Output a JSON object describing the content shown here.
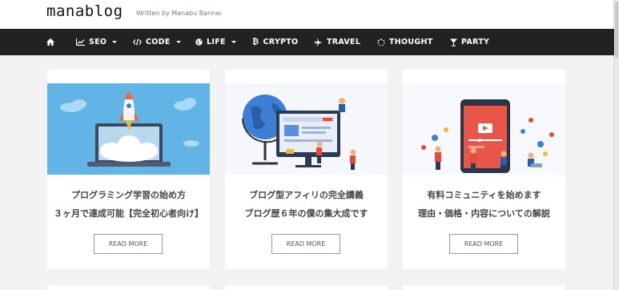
{
  "site": {
    "logo": "manablog",
    "tagline": "Written by Manabu Bannai"
  },
  "nav": [
    {
      "id": "home",
      "label": "",
      "icon": "home-icon",
      "dropdown": false
    },
    {
      "id": "seo",
      "label": "SEO",
      "icon": "chart-line-icon",
      "dropdown": true
    },
    {
      "id": "code",
      "label": "CODE",
      "icon": "code-icon",
      "dropdown": true
    },
    {
      "id": "life",
      "label": "LIFE",
      "icon": "globe-icon",
      "dropdown": true
    },
    {
      "id": "crypto",
      "label": "CRYPTO",
      "icon": "bitcoin-icon",
      "dropdown": false
    },
    {
      "id": "travel",
      "label": "TRAVEL",
      "icon": "plane-icon",
      "dropdown": false
    },
    {
      "id": "thought",
      "label": "THOUGHT",
      "icon": "spinner-icon",
      "dropdown": false
    },
    {
      "id": "party",
      "label": "PARTY",
      "icon": "cocktail-icon",
      "dropdown": false
    }
  ],
  "cards": [
    {
      "line1": "プログラミング学習の始め方",
      "line2": "３ヶ月で達成可能【完全初心者向け】",
      "button": "READ MORE",
      "image": "rocket-laptop-illustration"
    },
    {
      "line1": "ブログ型アフィリの完全講義",
      "line2": "ブログ歴６年の僕の集大成です",
      "button": "READ MORE",
      "image": "globe-blog-illustration"
    },
    {
      "line1": "有料コミュニティを始めます",
      "line2": "理由・価格・内容についての解説",
      "button": "READ MORE",
      "image": "video-community-illustration"
    }
  ],
  "colors": {
    "navbar": "#222222",
    "background": "#f2f2f2",
    "accent_blue": "#2f6fd6",
    "accent_red": "#e64a3c"
  }
}
